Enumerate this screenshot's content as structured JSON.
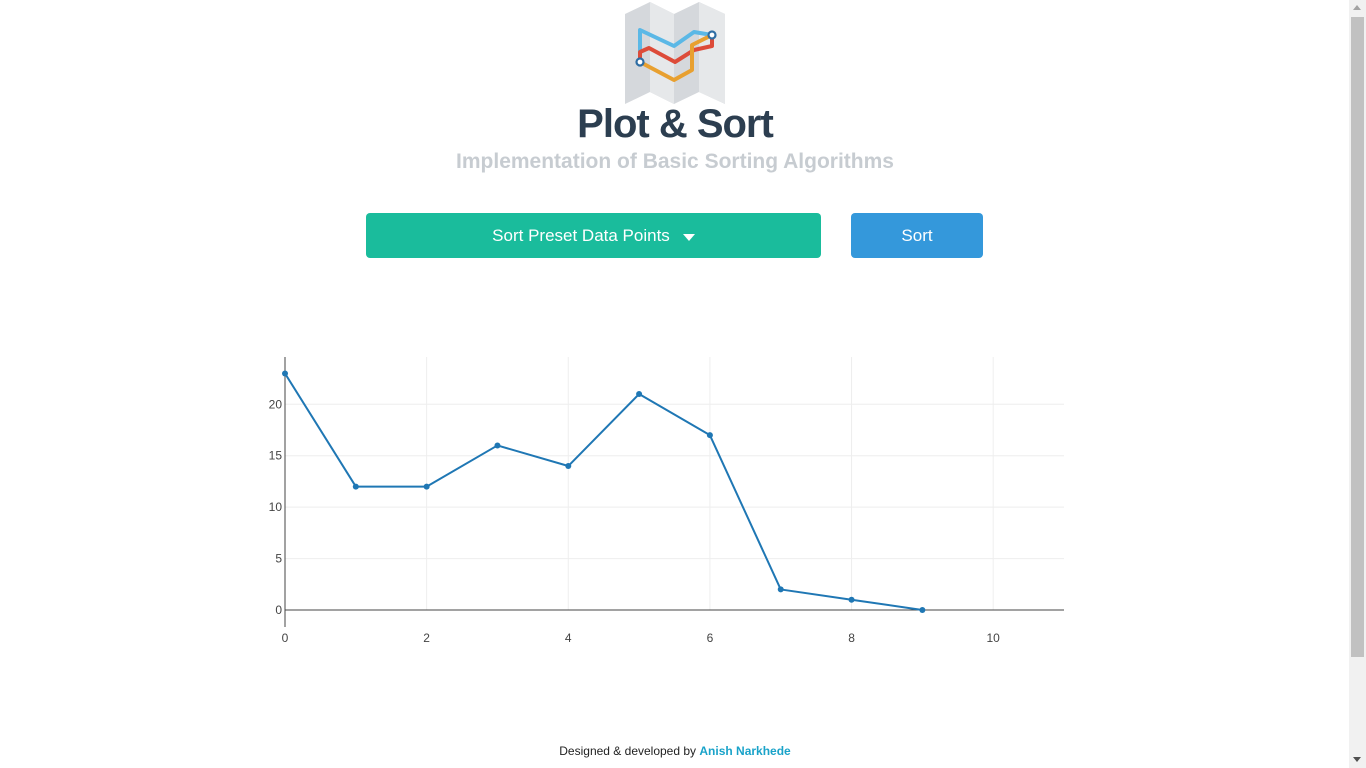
{
  "header": {
    "title": "Plot & Sort",
    "subtitle": "Implementation of Basic Sorting Algorithms"
  },
  "controls": {
    "select_label": "Sort Preset Data Points",
    "sort_label": "Sort"
  },
  "footer": {
    "prefix": "Designed & developed by ",
    "author": "Anish Narkhede"
  },
  "colors": {
    "select_button": "#1abc9c",
    "sort_button": "#3498db",
    "title": "#2c3e50",
    "subtitle": "#c7ccd1",
    "line": "#1f77b4",
    "author_link": "#1aa3c9"
  },
  "chart_data": {
    "type": "line",
    "x": [
      0,
      1,
      2,
      3,
      4,
      5,
      6,
      7,
      8,
      9
    ],
    "values": [
      23,
      12,
      12,
      16,
      14,
      21,
      17,
      2,
      1,
      0
    ],
    "title": "",
    "xlabel": "",
    "ylabel": "",
    "xlim": [
      0,
      11
    ],
    "ylim": [
      0,
      24.6
    ],
    "xticks": [
      "0",
      "2",
      "4",
      "6",
      "8",
      "10"
    ],
    "yticks": [
      "0",
      "5",
      "10",
      "15",
      "20"
    ],
    "grid": true,
    "markers": true
  }
}
